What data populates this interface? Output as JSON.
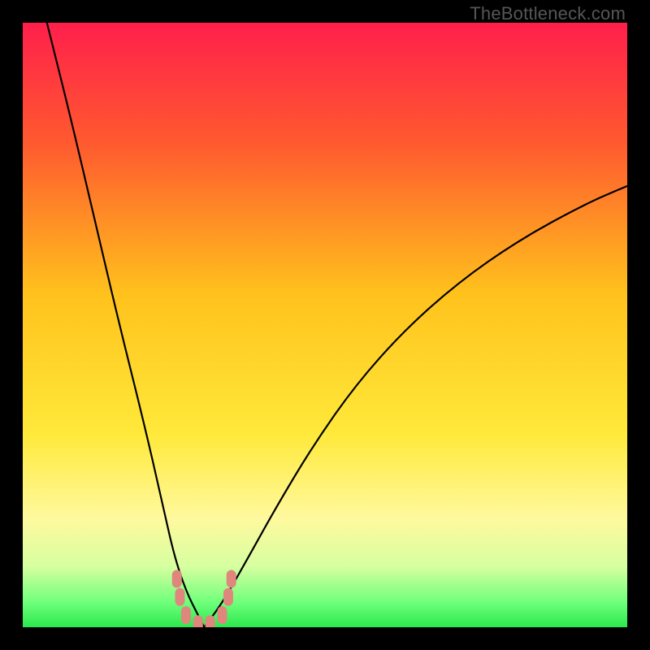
{
  "watermark": "TheBottleneck.com",
  "colors": {
    "black": "#000000",
    "curve": "#000000",
    "marker_fill": "#e0877d",
    "marker_stroke": "#e0877d",
    "green": "#2be84d"
  },
  "chart_data": {
    "type": "line",
    "title": "",
    "xlabel": "",
    "ylabel": "",
    "xlim": [
      0,
      100
    ],
    "ylim": [
      0,
      100
    ],
    "note": "Bottleneck-style V-curve. x is relative hardware balance index; y is bottleneck percentage (0 = optimal, 100 = worst). Minimum (optimal region) sits around x≈30. Background gradient shows good (green, bottom) to bad (red, top).",
    "series": [
      {
        "name": "left-branch",
        "x": [
          4,
          8,
          12,
          16,
          20,
          23,
          25,
          27,
          29,
          30
        ],
        "y": [
          100,
          84,
          67,
          50,
          34,
          21,
          12,
          6,
          2,
          0
        ]
      },
      {
        "name": "right-branch",
        "x": [
          30,
          33,
          37,
          42,
          48,
          55,
          63,
          72,
          82,
          93,
          100
        ],
        "y": [
          0,
          4,
          11,
          20,
          30,
          40,
          49,
          57,
          64,
          70,
          73
        ]
      }
    ],
    "markers": {
      "name": "optimal-range",
      "x": [
        25.5,
        26,
        27,
        29,
        31,
        33,
        34,
        34.5
      ],
      "y": [
        8,
        5,
        2,
        0.5,
        0.5,
        2,
        5,
        8
      ]
    },
    "gradient_stops": [
      {
        "pct": 0,
        "color": "#ff1f4b"
      },
      {
        "pct": 20,
        "color": "#ff5a2f"
      },
      {
        "pct": 45,
        "color": "#ffc21c"
      },
      {
        "pct": 68,
        "color": "#ffe93a"
      },
      {
        "pct": 82,
        "color": "#fff99e"
      },
      {
        "pct": 90,
        "color": "#d6ffa0"
      },
      {
        "pct": 96,
        "color": "#6dff7a"
      },
      {
        "pct": 100,
        "color": "#2be84d"
      }
    ]
  }
}
